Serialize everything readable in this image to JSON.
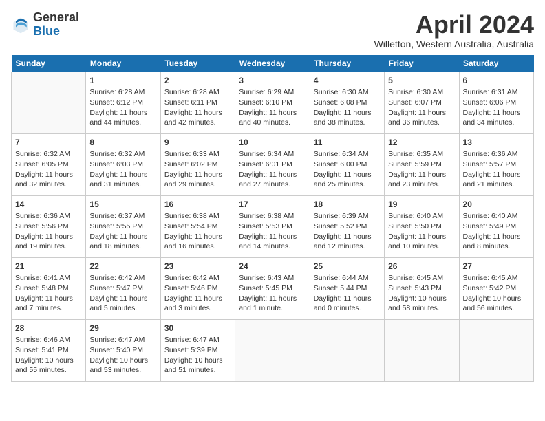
{
  "logo": {
    "general": "General",
    "blue": "Blue"
  },
  "title": {
    "month_year": "April 2024",
    "location": "Willetton, Western Australia, Australia"
  },
  "days_of_week": [
    "Sunday",
    "Monday",
    "Tuesday",
    "Wednesday",
    "Thursday",
    "Friday",
    "Saturday"
  ],
  "weeks": [
    [
      {
        "day": "",
        "info": ""
      },
      {
        "day": "1",
        "info": "Sunrise: 6:28 AM\nSunset: 6:12 PM\nDaylight: 11 hours\nand 44 minutes."
      },
      {
        "day": "2",
        "info": "Sunrise: 6:28 AM\nSunset: 6:11 PM\nDaylight: 11 hours\nand 42 minutes."
      },
      {
        "day": "3",
        "info": "Sunrise: 6:29 AM\nSunset: 6:10 PM\nDaylight: 11 hours\nand 40 minutes."
      },
      {
        "day": "4",
        "info": "Sunrise: 6:30 AM\nSunset: 6:08 PM\nDaylight: 11 hours\nand 38 minutes."
      },
      {
        "day": "5",
        "info": "Sunrise: 6:30 AM\nSunset: 6:07 PM\nDaylight: 11 hours\nand 36 minutes."
      },
      {
        "day": "6",
        "info": "Sunrise: 6:31 AM\nSunset: 6:06 PM\nDaylight: 11 hours\nand 34 minutes."
      }
    ],
    [
      {
        "day": "7",
        "info": "Sunrise: 6:32 AM\nSunset: 6:05 PM\nDaylight: 11 hours\nand 32 minutes."
      },
      {
        "day": "8",
        "info": "Sunrise: 6:32 AM\nSunset: 6:03 PM\nDaylight: 11 hours\nand 31 minutes."
      },
      {
        "day": "9",
        "info": "Sunrise: 6:33 AM\nSunset: 6:02 PM\nDaylight: 11 hours\nand 29 minutes."
      },
      {
        "day": "10",
        "info": "Sunrise: 6:34 AM\nSunset: 6:01 PM\nDaylight: 11 hours\nand 27 minutes."
      },
      {
        "day": "11",
        "info": "Sunrise: 6:34 AM\nSunset: 6:00 PM\nDaylight: 11 hours\nand 25 minutes."
      },
      {
        "day": "12",
        "info": "Sunrise: 6:35 AM\nSunset: 5:59 PM\nDaylight: 11 hours\nand 23 minutes."
      },
      {
        "day": "13",
        "info": "Sunrise: 6:36 AM\nSunset: 5:57 PM\nDaylight: 11 hours\nand 21 minutes."
      }
    ],
    [
      {
        "day": "14",
        "info": "Sunrise: 6:36 AM\nSunset: 5:56 PM\nDaylight: 11 hours\nand 19 minutes."
      },
      {
        "day": "15",
        "info": "Sunrise: 6:37 AM\nSunset: 5:55 PM\nDaylight: 11 hours\nand 18 minutes."
      },
      {
        "day": "16",
        "info": "Sunrise: 6:38 AM\nSunset: 5:54 PM\nDaylight: 11 hours\nand 16 minutes."
      },
      {
        "day": "17",
        "info": "Sunrise: 6:38 AM\nSunset: 5:53 PM\nDaylight: 11 hours\nand 14 minutes."
      },
      {
        "day": "18",
        "info": "Sunrise: 6:39 AM\nSunset: 5:52 PM\nDaylight: 11 hours\nand 12 minutes."
      },
      {
        "day": "19",
        "info": "Sunrise: 6:40 AM\nSunset: 5:50 PM\nDaylight: 11 hours\nand 10 minutes."
      },
      {
        "day": "20",
        "info": "Sunrise: 6:40 AM\nSunset: 5:49 PM\nDaylight: 11 hours\nand 8 minutes."
      }
    ],
    [
      {
        "day": "21",
        "info": "Sunrise: 6:41 AM\nSunset: 5:48 PM\nDaylight: 11 hours\nand 7 minutes."
      },
      {
        "day": "22",
        "info": "Sunrise: 6:42 AM\nSunset: 5:47 PM\nDaylight: 11 hours\nand 5 minutes."
      },
      {
        "day": "23",
        "info": "Sunrise: 6:42 AM\nSunset: 5:46 PM\nDaylight: 11 hours\nand 3 minutes."
      },
      {
        "day": "24",
        "info": "Sunrise: 6:43 AM\nSunset: 5:45 PM\nDaylight: 11 hours\nand 1 minute."
      },
      {
        "day": "25",
        "info": "Sunrise: 6:44 AM\nSunset: 5:44 PM\nDaylight: 11 hours\nand 0 minutes."
      },
      {
        "day": "26",
        "info": "Sunrise: 6:45 AM\nSunset: 5:43 PM\nDaylight: 10 hours\nand 58 minutes."
      },
      {
        "day": "27",
        "info": "Sunrise: 6:45 AM\nSunset: 5:42 PM\nDaylight: 10 hours\nand 56 minutes."
      }
    ],
    [
      {
        "day": "28",
        "info": "Sunrise: 6:46 AM\nSunset: 5:41 PM\nDaylight: 10 hours\nand 55 minutes."
      },
      {
        "day": "29",
        "info": "Sunrise: 6:47 AM\nSunset: 5:40 PM\nDaylight: 10 hours\nand 53 minutes."
      },
      {
        "day": "30",
        "info": "Sunrise: 6:47 AM\nSunset: 5:39 PM\nDaylight: 10 hours\nand 51 minutes."
      },
      {
        "day": "",
        "info": ""
      },
      {
        "day": "",
        "info": ""
      },
      {
        "day": "",
        "info": ""
      },
      {
        "day": "",
        "info": ""
      }
    ]
  ]
}
